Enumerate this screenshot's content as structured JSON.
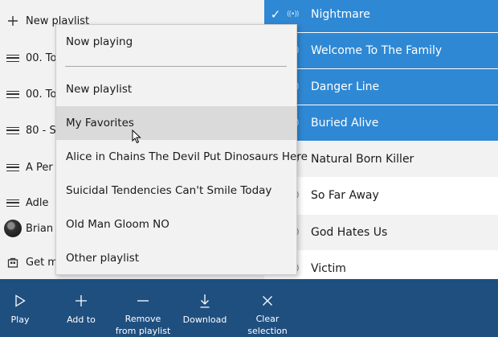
{
  "left_pane": {
    "items": [
      {
        "label": "New playlist",
        "icon": "plus-icon"
      },
      {
        "label": "00. To",
        "icon": "playlist-icon"
      },
      {
        "label": "00. To",
        "icon": "playlist-icon"
      },
      {
        "label": "80 - S",
        "icon": "playlist-icon"
      },
      {
        "label": "A Per",
        "icon": "playlist-icon"
      },
      {
        "label": "Adle",
        "icon": "playlist-icon"
      },
      {
        "label": "Brian",
        "icon": "avatar"
      },
      {
        "label": "Get m",
        "icon": "store-icon"
      }
    ]
  },
  "songs": [
    {
      "title": "Nightmare",
      "selected": true
    },
    {
      "title": "Welcome To The Family",
      "selected": true
    },
    {
      "title": "Danger Line",
      "selected": true
    },
    {
      "title": "Buried Alive",
      "selected": true
    },
    {
      "title": "Natural Born Killer",
      "selected": false
    },
    {
      "title": "So Far Away",
      "selected": false
    },
    {
      "title": "God Hates Us",
      "selected": false
    },
    {
      "title": "Victim",
      "selected": false
    }
  ],
  "menu": {
    "header": "Now playing",
    "items": [
      "New playlist",
      "My Favorites",
      "Alice in Chains The Devil Put Dinosaurs Here",
      "Suicidal Tendencies Can't Smile Today",
      "Old Man Gloom NO",
      "Other playlist"
    ],
    "hovered": "My Favorites"
  },
  "command_bar": {
    "play": "Play",
    "add_to": "Add to",
    "remove": "Remove\nfrom playlist",
    "download": "Download",
    "clear": "Clear\nselection"
  },
  "colors": {
    "selection": "#2f88d4",
    "command_bar": "#1f4f7f"
  }
}
